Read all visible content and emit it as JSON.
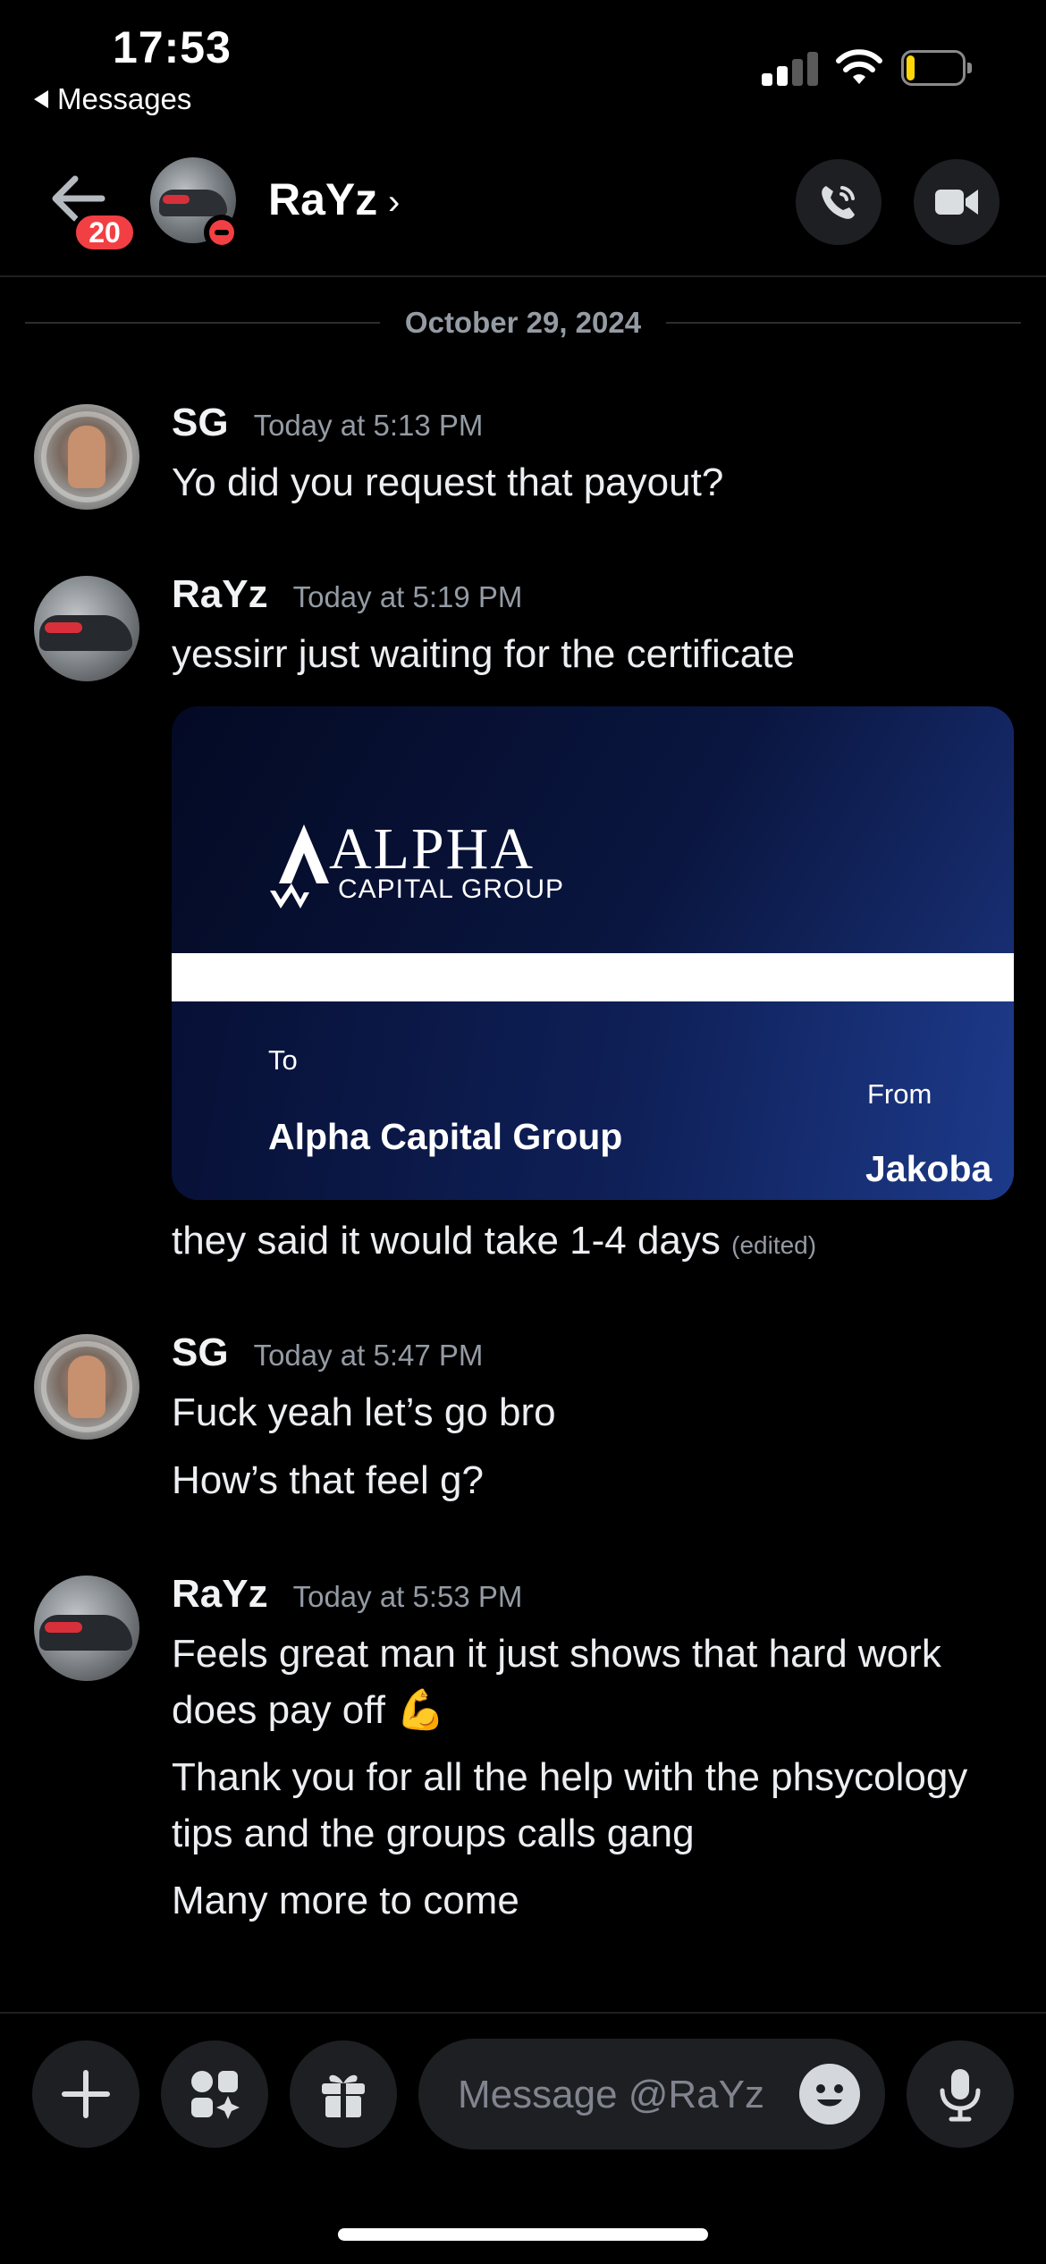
{
  "status_bar": {
    "time": "17:53",
    "back_app": "Messages",
    "battery_level": 0.15
  },
  "header": {
    "unread_badge": "20",
    "channel_name": "RaYz",
    "chevron": "›",
    "user_status": "do-not-disturb",
    "icons": [
      "back-arrow-icon",
      "phone-call-icon",
      "video-camera-icon"
    ]
  },
  "date_divider": "October 29, 2024",
  "messages": [
    {
      "author": "SG",
      "timestamp": "Today at 5:13 PM",
      "lines": [
        "Yo did you request that payout?"
      ]
    },
    {
      "author": "RaYz",
      "timestamp": "Today at 5:19 PM",
      "lines": [
        "yessirr just waiting for the certificate"
      ],
      "attachment": {
        "brand": "ALPHA",
        "brand_sub": "CAPITAL GROUP",
        "to_label": "To",
        "recipient": "Alpha Capital Group",
        "from_label": "From",
        "sender": "Jakoba"
      },
      "after_attachment": "they said it would take 1-4 days",
      "edited_label": "(edited)"
    },
    {
      "author": "SG",
      "timestamp": "Today at 5:47 PM",
      "lines": [
        "Fuck yeah let’s go bro",
        "How’s that feel g?"
      ]
    },
    {
      "author": "RaYz",
      "timestamp": "Today at 5:53 PM",
      "lines": [
        "Feels great man it just shows that hard work does pay off",
        "Thank you for all the help with the phsycology tips and the groups calls gang",
        "Many more to come"
      ],
      "emoji": "💪"
    }
  ],
  "composer": {
    "placeholder": "Message @RaYz",
    "icons": [
      "plus-icon",
      "apps-icon",
      "gift-icon",
      "emoji-icon",
      "microphone-icon"
    ]
  }
}
